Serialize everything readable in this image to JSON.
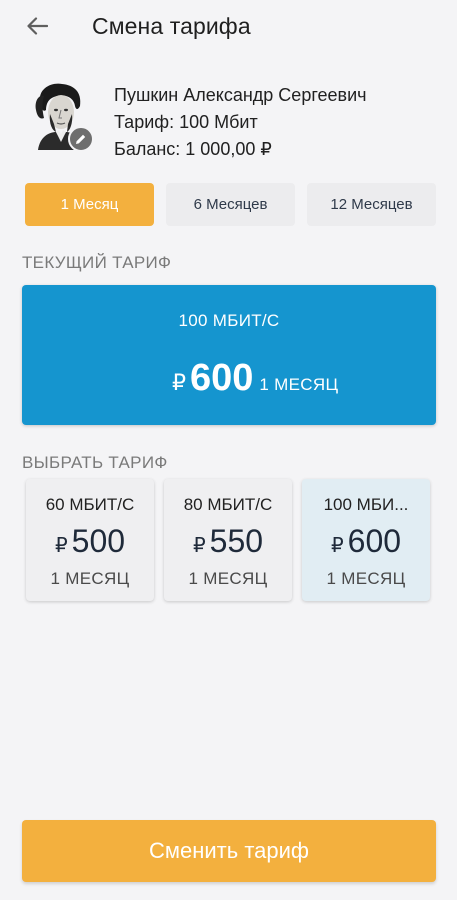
{
  "header": {
    "back_icon": "arrow-left-icon",
    "title": "Смена тарифа"
  },
  "profile": {
    "name": "Пушкин Александр Сергеевич",
    "tariff": "Тариф: 100 Мбит",
    "balance": "Баланс: 1 000,00 ₽",
    "edit_icon": "pencil-icon"
  },
  "periods": [
    {
      "label": "1 Месяц",
      "active": true
    },
    {
      "label": "6 Месяцев",
      "active": false
    },
    {
      "label": "12 Месяцев",
      "active": false
    }
  ],
  "current": {
    "section_label": "ТЕКУЩИЙ ТАРИФ",
    "speed": "100 МБИТ/С",
    "currency": "₽",
    "amount": "600",
    "period": "1 МЕСЯЦ"
  },
  "choose": {
    "section_label": "ВЫБРАТЬ ТАРИФ",
    "tariffs": [
      {
        "speed": "60 МБИТ/С",
        "currency": "₽",
        "amount": "500",
        "period": "1 МЕСЯЦ",
        "selected": false
      },
      {
        "speed": "80 МБИТ/С",
        "currency": "₽",
        "amount": "550",
        "period": "1 МЕСЯЦ",
        "selected": false
      },
      {
        "speed": "100 МБИ...",
        "currency": "₽",
        "amount": "600",
        "period": "1 МЕСЯЦ",
        "selected": true
      }
    ]
  },
  "submit_label": "Сменить тариф",
  "colors": {
    "accent": "#f3b03e",
    "current_card": "#1595cf",
    "selected_card": "#e1edf3"
  }
}
